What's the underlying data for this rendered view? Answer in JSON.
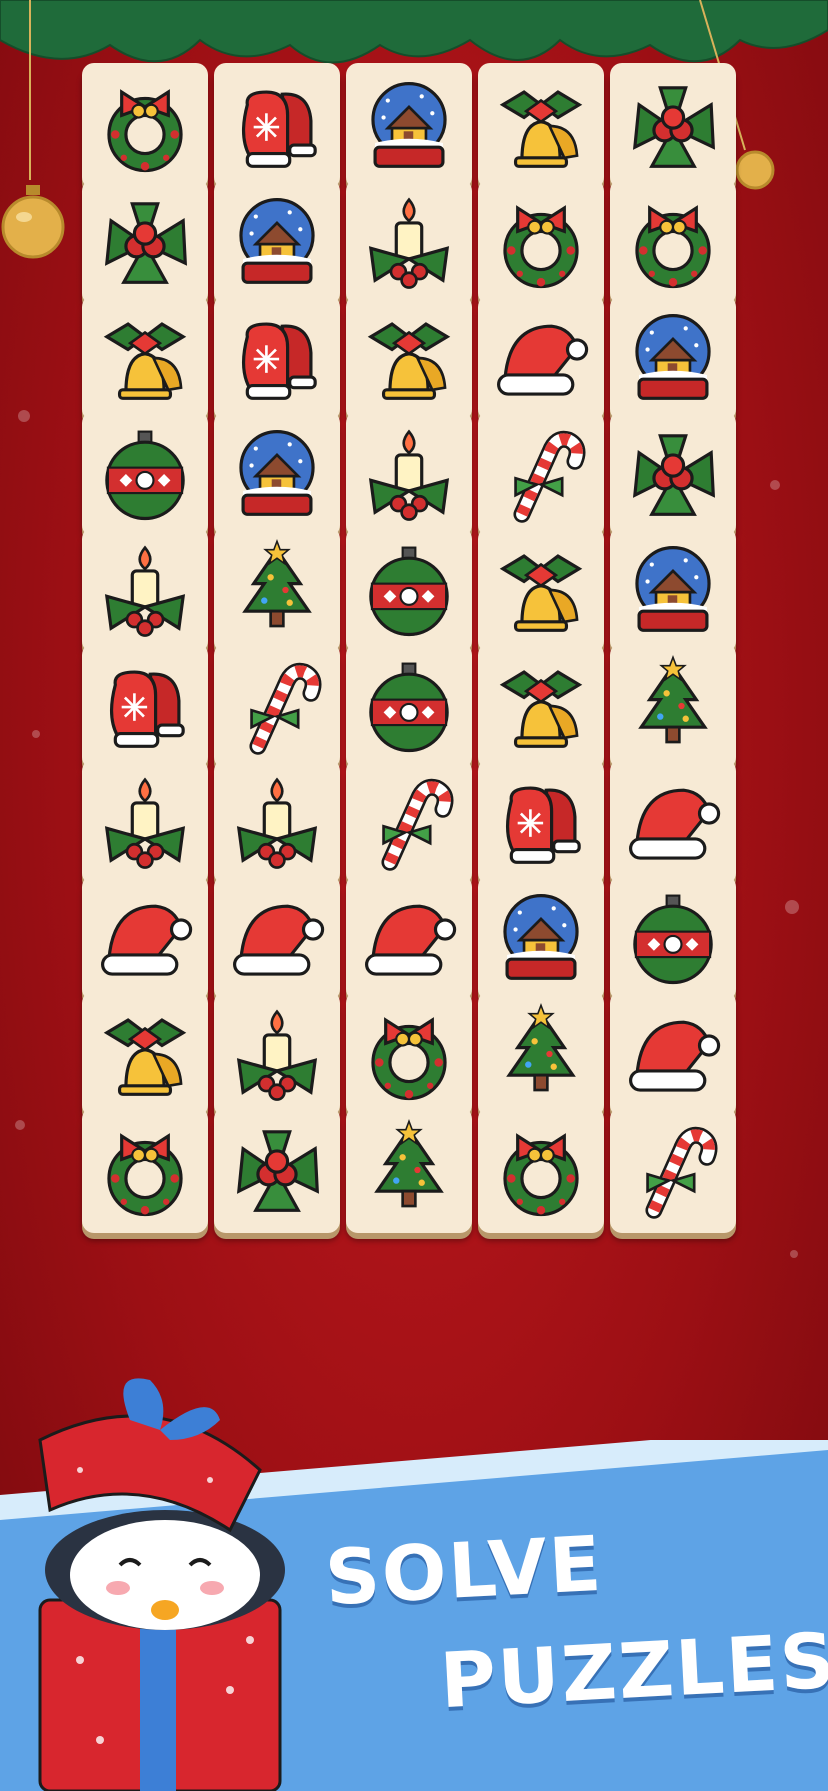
{
  "game": {
    "headline_line1": "SOLVE",
    "headline_line2": "PUZZLES!",
    "grid": {
      "columns": 5,
      "rows": 10,
      "tiles": [
        [
          "wreath",
          "mittens",
          "snow-globe",
          "bell",
          "holly"
        ],
        [
          "holly",
          "snow-globe",
          "candle",
          "wreath",
          "wreath"
        ],
        [
          "bell",
          "mittens",
          "bell",
          "santa-hat",
          "snow-globe"
        ],
        [
          "ornament",
          "snow-globe",
          "candle",
          "candy-cane",
          "holly"
        ],
        [
          "candle",
          "tree",
          "ornament",
          "bell",
          "snow-globe"
        ],
        [
          "mittens",
          "candy-cane",
          "ornament",
          "bell",
          "tree"
        ],
        [
          "candle",
          "candle",
          "candy-cane",
          "mittens",
          "santa-hat"
        ],
        [
          "santa-hat",
          "santa-hat",
          "santa-hat",
          "snow-globe",
          "ornament"
        ],
        [
          "bell",
          "candle",
          "wreath",
          "tree",
          "santa-hat"
        ],
        [
          "wreath",
          "holly",
          "tree",
          "wreath",
          "candy-cane"
        ]
      ]
    }
  },
  "colors": {
    "background": "#b3141a",
    "tile_face": "#f7ead5",
    "banner": "#5ea3e6",
    "headline": "#ffffff"
  }
}
